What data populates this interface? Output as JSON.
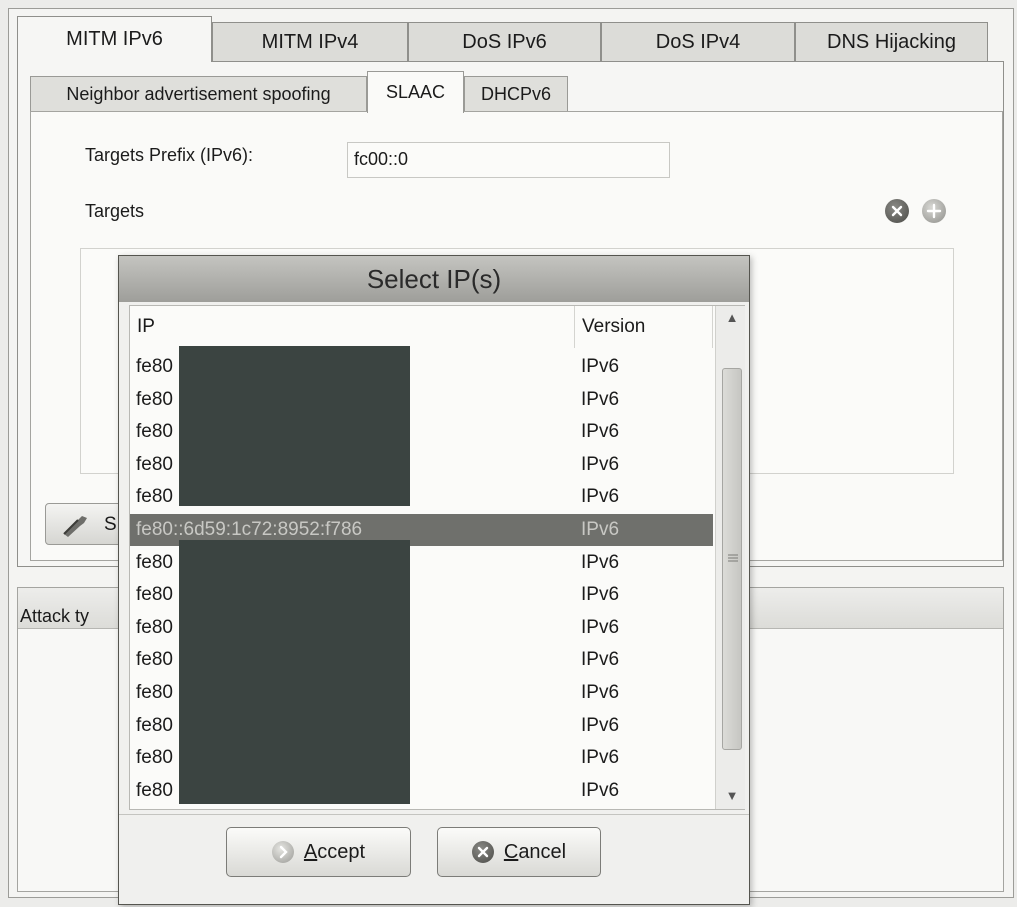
{
  "main_tabs": [
    "MITM IPv6",
    "MITM IPv4",
    "DoS IPv6",
    "DoS IPv4",
    "DNS Hijacking"
  ],
  "sub_tabs": [
    "Neighbor advertisement spoofing",
    "SLAAC",
    "DHCPv6"
  ],
  "form": {
    "prefix_label": "Targets Prefix (IPv6):",
    "prefix_value": "fc00::0",
    "targets_label": "Targets"
  },
  "scan_button_label": "S",
  "attack_panel_label": "Attack ty",
  "dialog": {
    "title": "Select IP(s)",
    "columns": [
      "IP",
      "Version"
    ],
    "rows": [
      {
        "ip": "fe80",
        "version": "IPv6"
      },
      {
        "ip": "fe80",
        "version": "IPv6"
      },
      {
        "ip": "fe80",
        "version": "IPv6"
      },
      {
        "ip": "fe80",
        "version": "IPv6"
      },
      {
        "ip": "fe80",
        "version": "IPv6"
      },
      {
        "ip": "fe80::6d59:1c72:8952:f786",
        "version": "IPv6"
      },
      {
        "ip": "fe80",
        "version": "IPv6"
      },
      {
        "ip": "fe80",
        "version": "IPv6"
      },
      {
        "ip": "fe80",
        "version": "IPv6"
      },
      {
        "ip": "fe80",
        "version": "IPv6"
      },
      {
        "ip": "fe80",
        "version": "IPv6"
      },
      {
        "ip": "fe80",
        "version": "IPv6"
      },
      {
        "ip": "fe80",
        "version": "IPv6"
      },
      {
        "ip": "fe80",
        "version": "IPv6"
      }
    ],
    "accept_label": "Accept",
    "cancel_label": "Cancel"
  },
  "icons": {
    "remove_target": "remove-circle-icon",
    "add_target": "add-circle-icon",
    "scan": "wrench-icon",
    "accept": "accept-circle-icon",
    "cancel": "cancel-circle-icon"
  },
  "colors": {
    "selected_row": "#6f706c",
    "redaction": "#3b4441",
    "dialog_title_bar": "#b1b1ad"
  }
}
